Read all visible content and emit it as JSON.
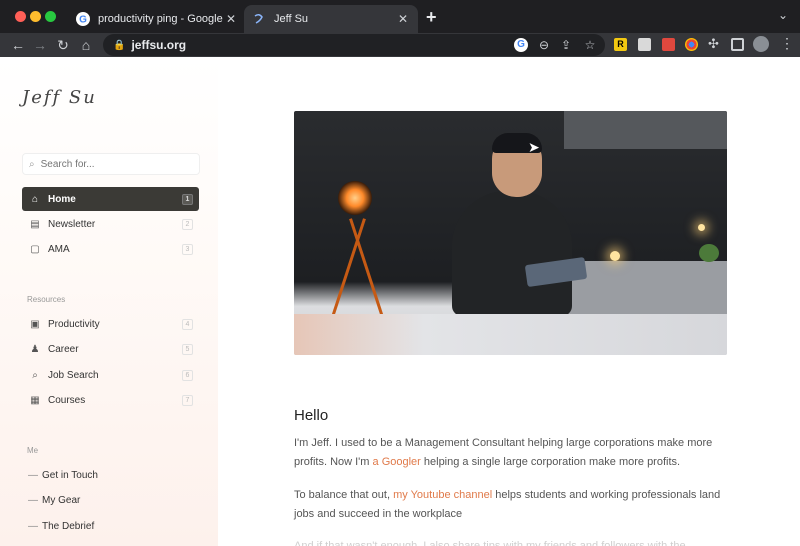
{
  "browser": {
    "tabs": [
      {
        "title": "productivity ping - Google Sea",
        "active": false
      },
      {
        "title": "Jeff Su",
        "active": true
      }
    ],
    "new_tab": "+",
    "url": "jeffsu.org"
  },
  "sidebar": {
    "signature": "Jeff Su",
    "search_placeholder": "Search for...",
    "main_items": [
      {
        "label": "Home",
        "key": "1",
        "icon": "home-icon"
      },
      {
        "label": "Newsletter",
        "key": "2",
        "icon": "newsletter-icon"
      },
      {
        "label": "AMA",
        "key": "3",
        "icon": "ama-icon"
      }
    ],
    "resources_label": "Resources",
    "resources": [
      {
        "label": "Productivity",
        "key": "4",
        "icon": "productivity-icon"
      },
      {
        "label": "Career",
        "key": "5",
        "icon": "career-icon"
      },
      {
        "label": "Job Search",
        "key": "6",
        "icon": "job-search-icon"
      },
      {
        "label": "Courses",
        "key": "7",
        "icon": "courses-icon"
      }
    ],
    "me_label": "Me",
    "me": [
      {
        "label": "Get in Touch"
      },
      {
        "label": "My Gear"
      },
      {
        "label": "The Debrief"
      }
    ]
  },
  "main": {
    "heading": "Hello",
    "para1_text": "I'm Jeff. I used to be a Management Consultant helping large corporations make more profits. Now I'm ",
    "para1_link": "a Googler",
    "para1_tail": " helping a single large corporation make more profits.",
    "para2_text": "To balance that out, ",
    "para2_link": "my Youtube channel",
    "para2_tail": " helps students and working professionals land jobs and succeed in the workplace",
    "para3_text": "And if that wasn't enough, I also share tips with my friends and followers with the"
  }
}
